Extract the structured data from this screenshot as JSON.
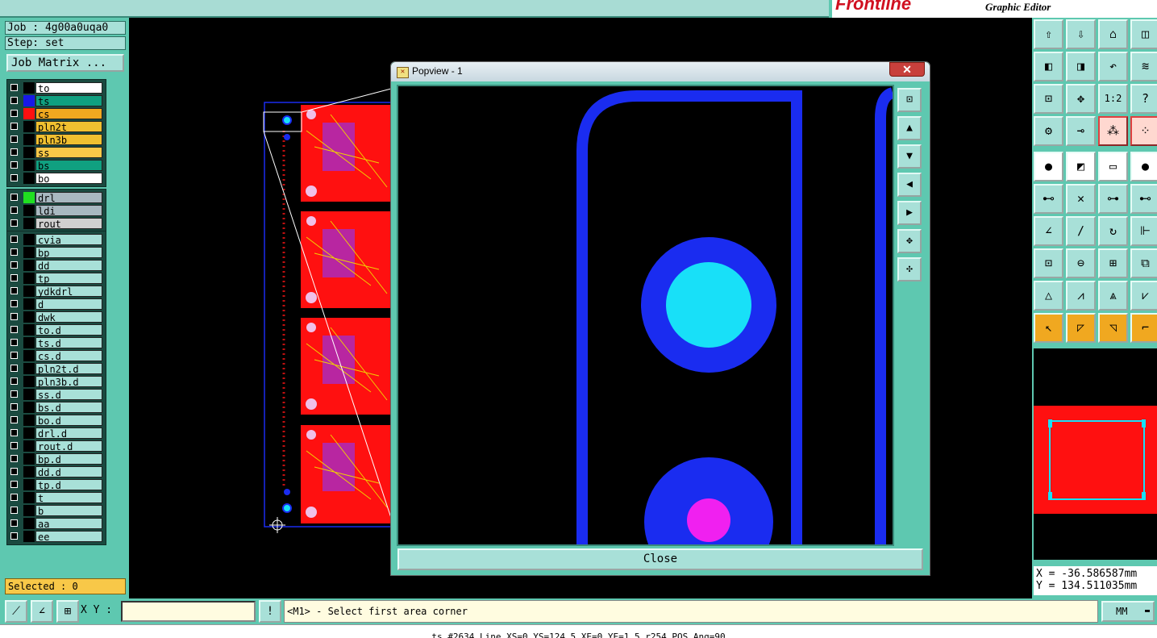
{
  "header": {
    "brand": "Frontline",
    "subtitle": "Graphic Editor"
  },
  "left": {
    "job_label": "Job : 4g00a0uqa0",
    "step_label": "Step: set",
    "job_matrix": "Job Matrix ...",
    "selected": "Selected : 0",
    "layers": [
      {
        "name": "to",
        "bg": "#ffffff",
        "swatch": "#000000"
      },
      {
        "name": "ts",
        "bg": "#10a080",
        "swatch": "#1818e8"
      },
      {
        "name": "cs",
        "bg": "#f0a820",
        "swatch": "#ff1010"
      },
      {
        "name": "pln2t",
        "bg": "#f0c030",
        "swatch": "#000000"
      },
      {
        "name": "pln3b",
        "bg": "#f0c030",
        "swatch": "#000000"
      },
      {
        "name": "ss",
        "bg": "#f8c848",
        "swatch": "#000000"
      },
      {
        "name": "bs",
        "bg": "#10a080",
        "swatch": "#000000"
      },
      {
        "name": "bo",
        "bg": "#ffffff",
        "swatch": "#000000"
      },
      {
        "name": "drl",
        "bg": "#a8b8c0",
        "swatch": "#20e020"
      },
      {
        "name": "ldi",
        "bg": "#a8b8c0",
        "swatch": "#000000"
      },
      {
        "name": "rout",
        "bg": "#d0d0d0",
        "swatch": "#000000"
      },
      {
        "name": "cvia",
        "bg": "#a8e0d8",
        "swatch": "#000000"
      },
      {
        "name": "bp",
        "bg": "#a8e0d8",
        "swatch": "#000000"
      },
      {
        "name": "dd",
        "bg": "#a8e0d8",
        "swatch": "#000000"
      },
      {
        "name": "tp",
        "bg": "#a8e0d8",
        "swatch": "#000000"
      },
      {
        "name": "ydkdrl",
        "bg": "#a8e0d8",
        "swatch": "#000000"
      },
      {
        "name": "d",
        "bg": "#a8e0d8",
        "swatch": "#000000"
      },
      {
        "name": "dwk",
        "bg": "#a8e0d8",
        "swatch": "#000000"
      },
      {
        "name": "to.d",
        "bg": "#a8e0d8",
        "swatch": "#000000"
      },
      {
        "name": "ts.d",
        "bg": "#a8e0d8",
        "swatch": "#000000"
      },
      {
        "name": "cs.d",
        "bg": "#a8e0d8",
        "swatch": "#000000"
      },
      {
        "name": "pln2t.d",
        "bg": "#a8e0d8",
        "swatch": "#000000"
      },
      {
        "name": "pln3b.d",
        "bg": "#a8e0d8",
        "swatch": "#000000"
      },
      {
        "name": "ss.d",
        "bg": "#a8e0d8",
        "swatch": "#000000"
      },
      {
        "name": "bs.d",
        "bg": "#a8e0d8",
        "swatch": "#000000"
      },
      {
        "name": "bo.d",
        "bg": "#a8e0d8",
        "swatch": "#000000"
      },
      {
        "name": "drl.d",
        "bg": "#a8e0d8",
        "swatch": "#000000"
      },
      {
        "name": "rout.d",
        "bg": "#a8e0d8",
        "swatch": "#000000"
      },
      {
        "name": "bp.d",
        "bg": "#a8e0d8",
        "swatch": "#000000"
      },
      {
        "name": "dd.d",
        "bg": "#a8e0d8",
        "swatch": "#000000"
      },
      {
        "name": "tp.d",
        "bg": "#a8e0d8",
        "swatch": "#000000"
      },
      {
        "name": "t",
        "bg": "#a8e0d8",
        "swatch": "#000000"
      },
      {
        "name": "b",
        "bg": "#a8e0d8",
        "swatch": "#000000"
      },
      {
        "name": "aa",
        "bg": "#a8e0d8",
        "swatch": "#000000"
      },
      {
        "name": "ee",
        "bg": "#a8e0d8",
        "swatch": "#000000"
      }
    ]
  },
  "popup": {
    "title": "Popview - 1",
    "close_x": "✕",
    "close_label": "Close"
  },
  "right": {
    "toolbar_icons": [
      "zoom-home-icon",
      "zoom-window-icon",
      "home-icon",
      "panel-icon",
      "pan-left-icon",
      "pan-right-icon",
      "undo-view-icon",
      "snap-icon",
      "fit-icon",
      "center-icon",
      "scale-1-2-icon",
      "help-icon",
      "measure-icon",
      "feature-icon",
      "connect-icon",
      "net-icon",
      "add-pad-icon",
      "draw-line-icon",
      "ruler-icon",
      "dot-icon",
      "node-icon",
      "cross-node-icon",
      "move-node-icon",
      "edit-node-icon",
      "angle-icon",
      "slash-icon",
      "arc-icon",
      "mirror-icon",
      "add-feature-icon",
      "delete-line-icon",
      "grid-icon",
      "shapes-icon",
      "triangle-icon",
      "triangle-up-icon",
      "triangle-bold-icon",
      "triangle-wide-icon",
      "select-arrow-icon",
      "select-box-icon",
      "select-lasso-icon",
      "select-path-icon"
    ],
    "scale_label": "1:2",
    "help_label": "?",
    "coord_x": "X = -36.586587mm",
    "coord_y": "Y = 134.511035mm"
  },
  "bottom": {
    "xy_label": "X Y :",
    "xy_value": "",
    "info_label": "!",
    "prompt": "<M1> - Select first area corner",
    "units": "MM",
    "status": "ts #2634 Line XS=0 YS=124.5 XE=0 YE=1.5 r254 POS Ang=90"
  },
  "colors": {
    "panel": "#5ec8b0",
    "button": "#a8e0d8",
    "copper_red": "#ff1010",
    "trace_blue": "#1a2cf0",
    "pad_cyan": "#18e0f8",
    "pad_magenta": "#f020f0",
    "selected_bg": "#f8c848"
  }
}
